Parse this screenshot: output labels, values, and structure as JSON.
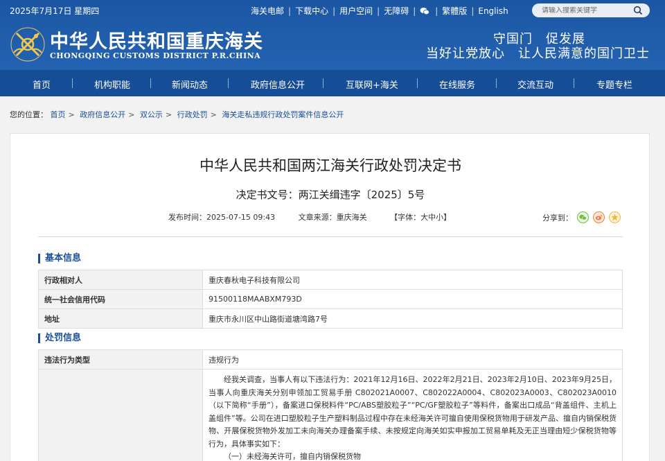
{
  "topbar": {
    "date": "2025年7月17日 星期四",
    "links": [
      "海关电邮",
      "下载中心",
      "用户空间",
      "无障碍",
      "繁體版",
      "English"
    ],
    "search_placeholder": "请输入搜索关键字"
  },
  "site": {
    "title": "中华人民共和国重庆海关",
    "subtitle": "CHONGQING CUSTOMS DISTRICT P.R.CHINA",
    "slogan_line1": "守国门　促发展",
    "slogan_line2": "当好让党放心　让人民满意的国门卫士"
  },
  "nav": {
    "items": [
      "首页",
      "机构职能",
      "新闻动态",
      "政府信息公开",
      "互联网+海关",
      "在线服务",
      "交流互动",
      "专题专栏"
    ],
    "active": "首页"
  },
  "breadcrumb": {
    "label": "您的位置：",
    "items": [
      "首页",
      "政府信息公开",
      "双公示",
      "行政处罚",
      "海关走私违规行政处罚案件信息公开"
    ]
  },
  "article": {
    "title": "中华人民共和国两江海关行政处罚决定书",
    "doc_number": "决定书文号：两江关缉违字〔2025〕5号",
    "publish_time": "发布时间：2025-07-15 09:43",
    "source": "文章来源：重庆海关",
    "font_size": "【字体：大中小】",
    "share_label": "分享到："
  },
  "basic_info": {
    "heading": "基本信息",
    "rows": [
      {
        "key": "行政相对人",
        "value": "重庆春秋电子科技有限公司"
      },
      {
        "key": "统一社会信用代码",
        "value": "91500118MAABXM793D"
      },
      {
        "key": "地址",
        "value": "重庆市永川区中山路街道塘湾路7号"
      }
    ]
  },
  "penalty_info": {
    "heading": "处罚信息",
    "type_key": "违法行为类型",
    "type_value": "违规行为",
    "facts_paragraph": "经我关调查，当事人有以下违法行为：2021年12月16日、2022年2月21日、2023年2月10日、2023年9月25日，当事人向重庆海关分别申领加工贸易手册 C802021A0007、C802022A0004、C802023A0003、C802023A0010（以下简称“手册”），备案进口保税料件“PC/ABS塑胶粒子”“PC/GF塑胶粒子”等料件，备案出口成品“背盖组件、主机上盖组件”等。公司在进口塑胶粒子生产塑料制品过程中存在未经海关许可擅自使用保税货物用于研发产品、擅自内销保税货物、开展保税货物外发加工未向海关办理备案手续、未按规定向海关如实申报加工贸易单耗及无正当理由短少保税货物等行为，具体事实如下：",
    "facts_item1": "（一）未经海关许可，擅自内销保税货物"
  },
  "colors": {
    "header_blue": "#1e5aa8",
    "nav_blue": "#154d96",
    "link_blue": "#1a4e96",
    "wechat_green": "#6cbf3d",
    "weibo_orange": "#f07a3a",
    "fav_yellow": "#f4b63a"
  }
}
